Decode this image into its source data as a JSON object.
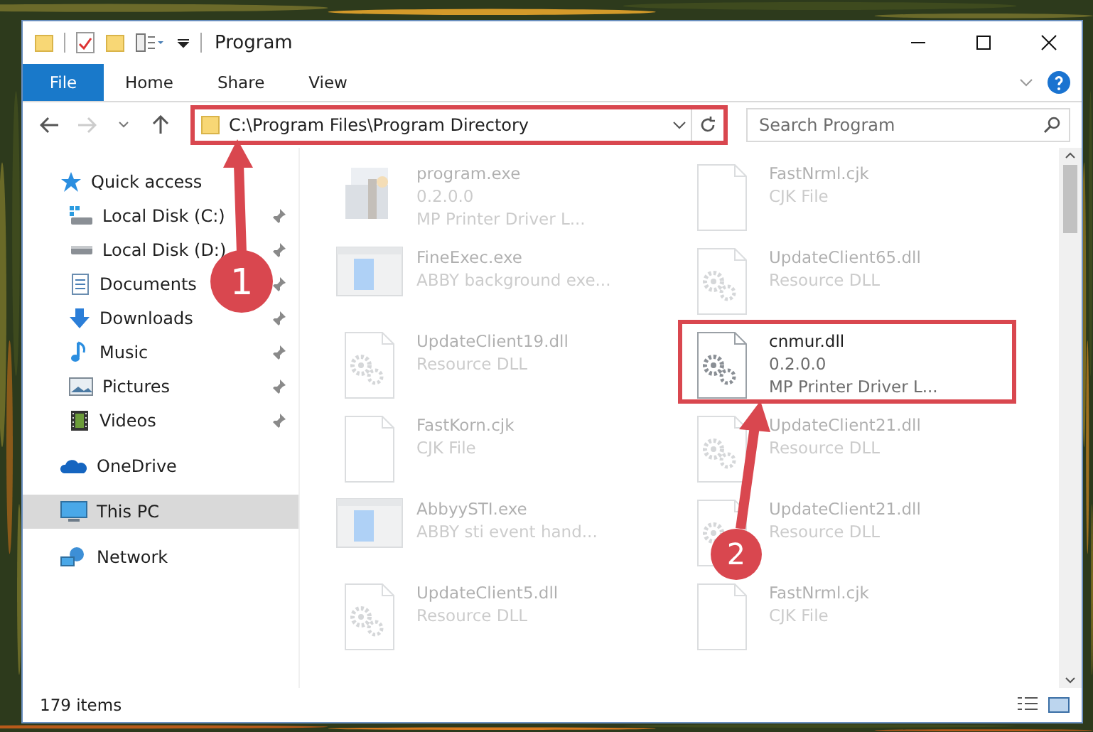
{
  "window": {
    "title": "Program"
  },
  "ribbon": {
    "file_button": "File",
    "tabs": [
      {
        "label": "Home",
        "selected": false
      },
      {
        "label": "Share",
        "selected": false
      },
      {
        "label": "View",
        "selected": false
      }
    ]
  },
  "address_bar": {
    "value": "C:\\Program Files\\Program Directory",
    "highlighted": true
  },
  "search": {
    "placeholder": "Search Program"
  },
  "navigation": {
    "items": [
      {
        "label": "Quick access",
        "kind": "star",
        "selected": false,
        "children": [
          {
            "label": "Local Disk (C:)",
            "kind": "system-drive",
            "pinned": true,
            "selected": false
          },
          {
            "label": "Local Disk (D:)",
            "kind": "drive",
            "pinned": true,
            "selected": false
          },
          {
            "label": "Documents",
            "kind": "documents",
            "pinned": true,
            "selected": false
          },
          {
            "label": "Downloads",
            "kind": "downloads",
            "pinned": true,
            "selected": false
          },
          {
            "label": "Music",
            "kind": "music",
            "pinned": true,
            "selected": false
          },
          {
            "label": "Pictures",
            "kind": "pictures",
            "pinned": true,
            "selected": false
          },
          {
            "label": "Videos",
            "kind": "videos",
            "pinned": true,
            "selected": false
          }
        ]
      },
      {
        "label": "OneDrive",
        "kind": "cloud",
        "selected": false
      },
      {
        "label": "This PC",
        "kind": "computer",
        "selected": true
      },
      {
        "label": "Network",
        "kind": "network",
        "selected": false
      }
    ]
  },
  "files": [
    {
      "name": "program.exe",
      "details": [
        "0.2.0.0",
        "MP Printer Driver L..."
      ],
      "kind": "installer",
      "faded": true,
      "highlighted": false
    },
    {
      "name": "FastNrml.cjk",
      "details": [
        "CJK File"
      ],
      "kind": "blank",
      "faded": true,
      "highlighted": false
    },
    {
      "name": "FineExec.exe",
      "details": [
        "ABBY background exe..."
      ],
      "kind": "window",
      "faded": true,
      "highlighted": false
    },
    {
      "name": "UpdateClient65.dll",
      "details": [
        "Resource DLL"
      ],
      "kind": "dll",
      "faded": true,
      "highlighted": false
    },
    {
      "name": "UpdateClient19.dll",
      "details": [
        "Resource DLL"
      ],
      "kind": "dll",
      "faded": true,
      "highlighted": false
    },
    {
      "name": "cnmur.dll",
      "details": [
        "0.2.0.0",
        "MP Printer Driver L..."
      ],
      "kind": "dll",
      "faded": false,
      "highlighted": true
    },
    {
      "name": "FastKorn.cjk",
      "details": [
        "CJK File"
      ],
      "kind": "blank",
      "faded": true,
      "highlighted": false
    },
    {
      "name": "UpdateClient21.dll",
      "details": [
        "Resource DLL"
      ],
      "kind": "dll",
      "faded": true,
      "highlighted": false
    },
    {
      "name": "AbbyySTI.exe",
      "details": [
        "ABBY sti event hand..."
      ],
      "kind": "window",
      "faded": true,
      "highlighted": false
    },
    {
      "name": "UpdateClient21.dll",
      "details": [
        "Resource DLL"
      ],
      "kind": "dll",
      "faded": true,
      "highlighted": false
    },
    {
      "name": "UpdateClient5.dll",
      "details": [
        "Resource DLL"
      ],
      "kind": "dll",
      "faded": true,
      "highlighted": false
    },
    {
      "name": "FastNrml.cjk",
      "details": [
        "CJK File"
      ],
      "kind": "blank",
      "faded": true,
      "highlighted": false
    }
  ],
  "status_bar": {
    "item_count": "179 items"
  },
  "annotations": [
    {
      "number": "1"
    },
    {
      "number": "2"
    }
  ]
}
